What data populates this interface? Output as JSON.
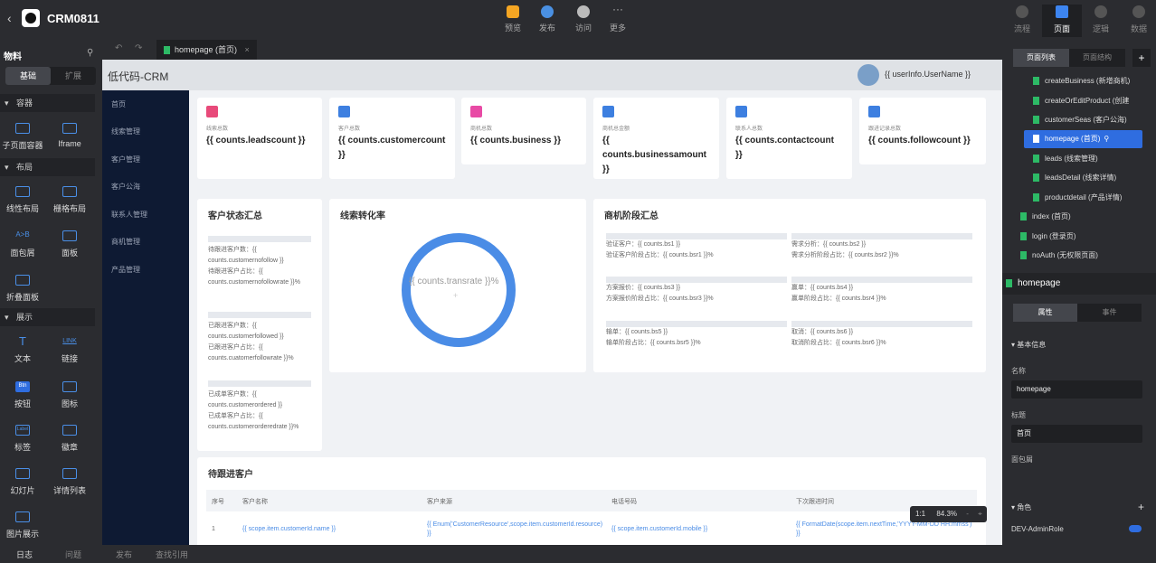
{
  "app": {
    "name": "CRM0811"
  },
  "toolbar": {
    "actions": [
      {
        "label": "预览",
        "icon": "preview-icon",
        "color": "#f5a623"
      },
      {
        "label": "发布",
        "icon": "cloud-icon",
        "color": "#4a90e2"
      },
      {
        "label": "访问",
        "icon": "arrow-right-icon",
        "color": "#bbbbbb"
      },
      {
        "label": "更多",
        "icon": "more-icon",
        "color": "#2b2c30"
      }
    ]
  },
  "right_tabs": [
    {
      "label": "流程",
      "icon": "flow-icon"
    },
    {
      "label": "页面",
      "icon": "page-icon"
    },
    {
      "label": "逻辑",
      "icon": "logic-icon"
    },
    {
      "label": "数据",
      "icon": "data-icon"
    }
  ],
  "materials": {
    "title": "物料",
    "tabs": [
      "基础",
      "扩展"
    ],
    "sections": {
      "container": "容器",
      "layout": "布局",
      "display": "展示"
    },
    "components": {
      "subpage": "子页面容器",
      "iframe": "Iframe",
      "linear": "线性布局",
      "grid": "栅格布局",
      "panel_wrap": "面包屑",
      "panel": "面板",
      "folding": "折叠面板",
      "text": "文本",
      "link": "链接",
      "link_icon": "LINK",
      "button": "按钮",
      "button_icon": "Btn",
      "icon": "图标",
      "tag": "标签",
      "tag_icon": "Label",
      "badge": "徽章",
      "slides": "幻灯片",
      "detail": "详情列表",
      "image": "图片展示"
    }
  },
  "editor": {
    "tab_label": "homepage (首页)"
  },
  "page": {
    "title": "低代码-CRM",
    "user": "{{ userInfo.UserName }}",
    "nav": [
      "首页",
      "线索管理",
      "客户管理",
      "客户公海",
      "联系人管理",
      "商机管理",
      "产品管理"
    ],
    "kpis": [
      {
        "label": "线索总数",
        "value": "{{ counts.leadscount }}",
        "color": "#e84a7a",
        "icon_text": "6|9"
      },
      {
        "label": "客户总数",
        "value": "{{ counts.customercount }}",
        "color": "#3d7fe0",
        "icon_text": "R"
      },
      {
        "label": "商机总数",
        "value": "{{ counts.business }}",
        "color": "#e84aa5",
        "icon_text": "S"
      },
      {
        "label": "商机总金额",
        "value": "{{ counts.businessamount }}",
        "color": "#3d7fe0",
        "icon_text": "¥"
      },
      {
        "label": "联系人总数",
        "value": "{{ counts.contactcount }}",
        "color": "#3d7fe0",
        "icon_text": "☎"
      },
      {
        "label": "跟进记录总数",
        "value": "{{ counts.followcount }}",
        "color": "#3d7fe0",
        "icon_text": "✎"
      }
    ],
    "customer_status": {
      "title": "客户状态汇总",
      "lines": [
        "待跟进客户数：{{ counts.customernofollow }}",
        "待跟进客户占比：{{ counts.customernofollowrate }}%",
        "已跟进客户数：{{ counts.customerfollowed }}",
        "已跟进客户占比：{{ counts.cuatomerfollowrate }}%",
        "已成单客户数：{{ counts.customerordered }}",
        "已成单客户占比：{{ counts.customerorderedrate }}%"
      ]
    },
    "conversion": {
      "title": "线索转化率",
      "value": "{{ counts.transrate }}%",
      "plus": "+"
    },
    "stages": {
      "title": "商机阶段汇总",
      "items": [
        {
          "count": "验证客户：{{ counts.bs1 }}",
          "rate": "验证客户阶段占比：{{ counts.bsr1 }}%"
        },
        {
          "count": "需求分析：{{ counts.bs2 }}",
          "rate": "需求分析阶段占比：{{ counts.bsr2 }}%"
        },
        {
          "count": "方案报价：{{ counts.bs3 }}",
          "rate": "方案报价阶段占比：{{ counts.bsr3 }}%"
        },
        {
          "count": "赢单：{{ counts.bs4 }}",
          "rate": "赢单阶段占比：{{ counts.bsr4 }}%"
        },
        {
          "count": "输单：{{ counts.bs5 }}",
          "rate": "输单阶段占比：{{ counts.bsr5 }}%"
        },
        {
          "count": "取消：{{ counts.bs6 }}",
          "rate": "取消阶段占比：{{ counts.bsr6 }}%"
        }
      ]
    },
    "followup": {
      "title": "待跟进客户",
      "columns": [
        "序号",
        "客户名称",
        "客户来源",
        "电话号码",
        "下次跟进时间"
      ],
      "row": [
        "1",
        "{{ scope.item.customerId.name }}",
        "{{ Enum('CustomerResource',scope.item.customerId.resource) }}",
        "{{ scope.item.customerId.mobile }}",
        "{{ FormatDate(scope.item.nextTime,'YYYY-MM-DD HH:mmss') }}"
      ]
    }
  },
  "zoom": {
    "ratio": "1:1",
    "level": "84.3%"
  },
  "pages_panel": {
    "tabs": [
      "页面列表",
      "页面结构"
    ],
    "add": "+",
    "items": [
      "createBusiness (新增商机)",
      "createOrEditProduct (创建",
      "customerSeas (客户公海)",
      "homepage (首页)",
      "leads (线索管理)",
      "leadsDetail (线索详情)",
      "productdetail (产品详情)",
      "index (首页)",
      "login (登录页)",
      "noAuth (无权限页面)"
    ]
  },
  "props": {
    "page_name": "homepage",
    "tabs": [
      "属性",
      "事件"
    ],
    "section": "基本信息",
    "name_label": "名称",
    "name_value": "homepage",
    "title_label": "标题",
    "title_value": "首页",
    "breadcrumb_label": "面包屑",
    "roles_label": "角色",
    "roles_add": "+",
    "role": "DEV-AdminRole"
  },
  "bottom": [
    "日志",
    "问题",
    "发布",
    "查找引用"
  ]
}
